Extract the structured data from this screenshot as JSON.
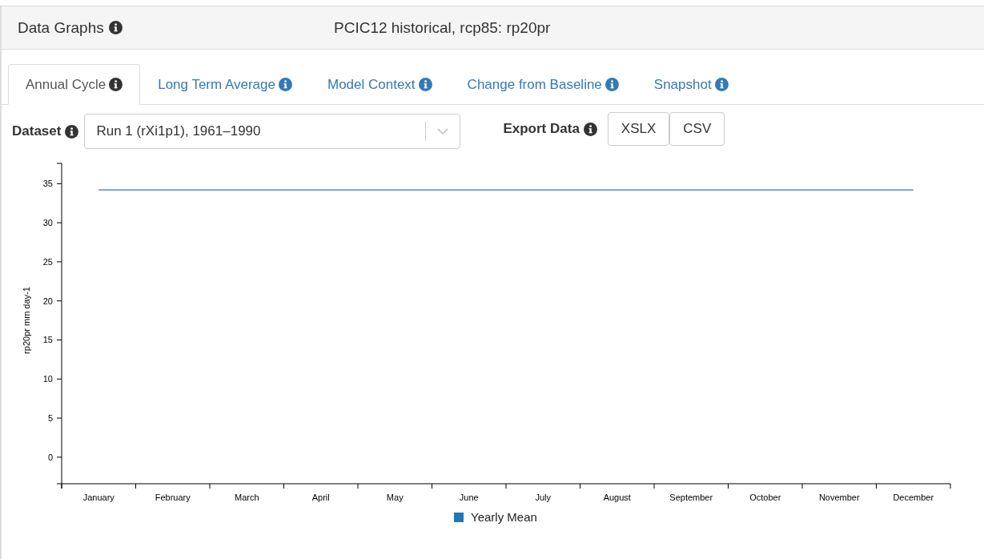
{
  "panel": {
    "title": "Data Graphs",
    "subtitle": "PCIC12 historical, rcp85: rp20pr"
  },
  "tabs": [
    {
      "label": "Annual Cycle",
      "selected": true
    },
    {
      "label": "Long Term Average",
      "selected": false
    },
    {
      "label": "Model Context",
      "selected": false
    },
    {
      "label": "Change from Baseline",
      "selected": false
    },
    {
      "label": "Snapshot",
      "selected": false
    }
  ],
  "dataset": {
    "label": "Dataset",
    "value": "Run 1 (rXi1p1), 1961–1990"
  },
  "export": {
    "label": "Export Data",
    "buttons": [
      "XSLX",
      "CSV"
    ]
  },
  "chart_data": {
    "type": "line",
    "ylabel": "rp20pr mm day-1",
    "categories": [
      "January",
      "February",
      "March",
      "April",
      "May",
      "June",
      "July",
      "August",
      "September",
      "October",
      "November",
      "December"
    ],
    "series": [
      {
        "name": "Yearly Mean",
        "color": "#1f78b4",
        "values": [
          34.2,
          34.2,
          34.2,
          34.2,
          34.2,
          34.2,
          34.2,
          34.2,
          34.2,
          34.2,
          34.2,
          34.2
        ]
      }
    ],
    "ylim": [
      -3.4,
      37.6
    ],
    "yticks": [
      0,
      5,
      10,
      15,
      20,
      25,
      30,
      35
    ]
  }
}
